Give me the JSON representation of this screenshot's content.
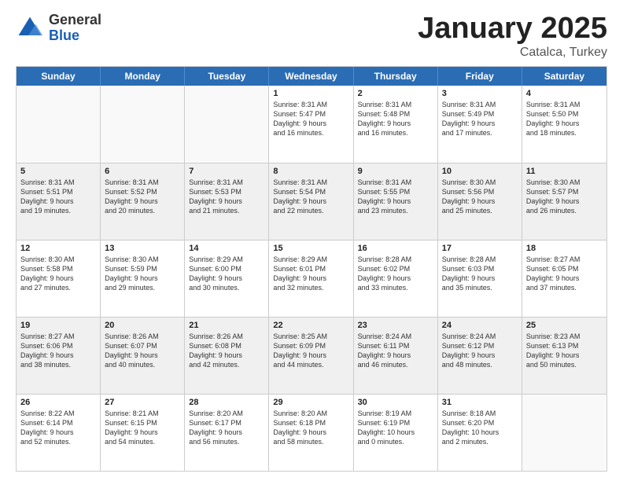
{
  "logo": {
    "general": "General",
    "blue": "Blue"
  },
  "header": {
    "month": "January 2025",
    "location": "Catalca, Turkey"
  },
  "weekdays": [
    "Sunday",
    "Monday",
    "Tuesday",
    "Wednesday",
    "Thursday",
    "Friday",
    "Saturday"
  ],
  "weeks": [
    [
      {
        "day": "",
        "data": "",
        "shaded": false,
        "empty": true
      },
      {
        "day": "",
        "data": "",
        "shaded": false,
        "empty": true
      },
      {
        "day": "",
        "data": "",
        "shaded": false,
        "empty": true
      },
      {
        "day": "1",
        "data": "Sunrise: 8:31 AM\nSunset: 5:47 PM\nDaylight: 9 hours\nand 16 minutes.",
        "shaded": false,
        "empty": false
      },
      {
        "day": "2",
        "data": "Sunrise: 8:31 AM\nSunset: 5:48 PM\nDaylight: 9 hours\nand 16 minutes.",
        "shaded": false,
        "empty": false
      },
      {
        "day": "3",
        "data": "Sunrise: 8:31 AM\nSunset: 5:49 PM\nDaylight: 9 hours\nand 17 minutes.",
        "shaded": false,
        "empty": false
      },
      {
        "day": "4",
        "data": "Sunrise: 8:31 AM\nSunset: 5:50 PM\nDaylight: 9 hours\nand 18 minutes.",
        "shaded": false,
        "empty": false
      }
    ],
    [
      {
        "day": "5",
        "data": "Sunrise: 8:31 AM\nSunset: 5:51 PM\nDaylight: 9 hours\nand 19 minutes.",
        "shaded": true,
        "empty": false
      },
      {
        "day": "6",
        "data": "Sunrise: 8:31 AM\nSunset: 5:52 PM\nDaylight: 9 hours\nand 20 minutes.",
        "shaded": true,
        "empty": false
      },
      {
        "day": "7",
        "data": "Sunrise: 8:31 AM\nSunset: 5:53 PM\nDaylight: 9 hours\nand 21 minutes.",
        "shaded": true,
        "empty": false
      },
      {
        "day": "8",
        "data": "Sunrise: 8:31 AM\nSunset: 5:54 PM\nDaylight: 9 hours\nand 22 minutes.",
        "shaded": true,
        "empty": false
      },
      {
        "day": "9",
        "data": "Sunrise: 8:31 AM\nSunset: 5:55 PM\nDaylight: 9 hours\nand 23 minutes.",
        "shaded": true,
        "empty": false
      },
      {
        "day": "10",
        "data": "Sunrise: 8:30 AM\nSunset: 5:56 PM\nDaylight: 9 hours\nand 25 minutes.",
        "shaded": true,
        "empty": false
      },
      {
        "day": "11",
        "data": "Sunrise: 8:30 AM\nSunset: 5:57 PM\nDaylight: 9 hours\nand 26 minutes.",
        "shaded": true,
        "empty": false
      }
    ],
    [
      {
        "day": "12",
        "data": "Sunrise: 8:30 AM\nSunset: 5:58 PM\nDaylight: 9 hours\nand 27 minutes.",
        "shaded": false,
        "empty": false
      },
      {
        "day": "13",
        "data": "Sunrise: 8:30 AM\nSunset: 5:59 PM\nDaylight: 9 hours\nand 29 minutes.",
        "shaded": false,
        "empty": false
      },
      {
        "day": "14",
        "data": "Sunrise: 8:29 AM\nSunset: 6:00 PM\nDaylight: 9 hours\nand 30 minutes.",
        "shaded": false,
        "empty": false
      },
      {
        "day": "15",
        "data": "Sunrise: 8:29 AM\nSunset: 6:01 PM\nDaylight: 9 hours\nand 32 minutes.",
        "shaded": false,
        "empty": false
      },
      {
        "day": "16",
        "data": "Sunrise: 8:28 AM\nSunset: 6:02 PM\nDaylight: 9 hours\nand 33 minutes.",
        "shaded": false,
        "empty": false
      },
      {
        "day": "17",
        "data": "Sunrise: 8:28 AM\nSunset: 6:03 PM\nDaylight: 9 hours\nand 35 minutes.",
        "shaded": false,
        "empty": false
      },
      {
        "day": "18",
        "data": "Sunrise: 8:27 AM\nSunset: 6:05 PM\nDaylight: 9 hours\nand 37 minutes.",
        "shaded": false,
        "empty": false
      }
    ],
    [
      {
        "day": "19",
        "data": "Sunrise: 8:27 AM\nSunset: 6:06 PM\nDaylight: 9 hours\nand 38 minutes.",
        "shaded": true,
        "empty": false
      },
      {
        "day": "20",
        "data": "Sunrise: 8:26 AM\nSunset: 6:07 PM\nDaylight: 9 hours\nand 40 minutes.",
        "shaded": true,
        "empty": false
      },
      {
        "day": "21",
        "data": "Sunrise: 8:26 AM\nSunset: 6:08 PM\nDaylight: 9 hours\nand 42 minutes.",
        "shaded": true,
        "empty": false
      },
      {
        "day": "22",
        "data": "Sunrise: 8:25 AM\nSunset: 6:09 PM\nDaylight: 9 hours\nand 44 minutes.",
        "shaded": true,
        "empty": false
      },
      {
        "day": "23",
        "data": "Sunrise: 8:24 AM\nSunset: 6:11 PM\nDaylight: 9 hours\nand 46 minutes.",
        "shaded": true,
        "empty": false
      },
      {
        "day": "24",
        "data": "Sunrise: 8:24 AM\nSunset: 6:12 PM\nDaylight: 9 hours\nand 48 minutes.",
        "shaded": true,
        "empty": false
      },
      {
        "day": "25",
        "data": "Sunrise: 8:23 AM\nSunset: 6:13 PM\nDaylight: 9 hours\nand 50 minutes.",
        "shaded": true,
        "empty": false
      }
    ],
    [
      {
        "day": "26",
        "data": "Sunrise: 8:22 AM\nSunset: 6:14 PM\nDaylight: 9 hours\nand 52 minutes.",
        "shaded": false,
        "empty": false
      },
      {
        "day": "27",
        "data": "Sunrise: 8:21 AM\nSunset: 6:15 PM\nDaylight: 9 hours\nand 54 minutes.",
        "shaded": false,
        "empty": false
      },
      {
        "day": "28",
        "data": "Sunrise: 8:20 AM\nSunset: 6:17 PM\nDaylight: 9 hours\nand 56 minutes.",
        "shaded": false,
        "empty": false
      },
      {
        "day": "29",
        "data": "Sunrise: 8:20 AM\nSunset: 6:18 PM\nDaylight: 9 hours\nand 58 minutes.",
        "shaded": false,
        "empty": false
      },
      {
        "day": "30",
        "data": "Sunrise: 8:19 AM\nSunset: 6:19 PM\nDaylight: 10 hours\nand 0 minutes.",
        "shaded": false,
        "empty": false
      },
      {
        "day": "31",
        "data": "Sunrise: 8:18 AM\nSunset: 6:20 PM\nDaylight: 10 hours\nand 2 minutes.",
        "shaded": false,
        "empty": false
      },
      {
        "day": "",
        "data": "",
        "shaded": false,
        "empty": true
      }
    ]
  ]
}
